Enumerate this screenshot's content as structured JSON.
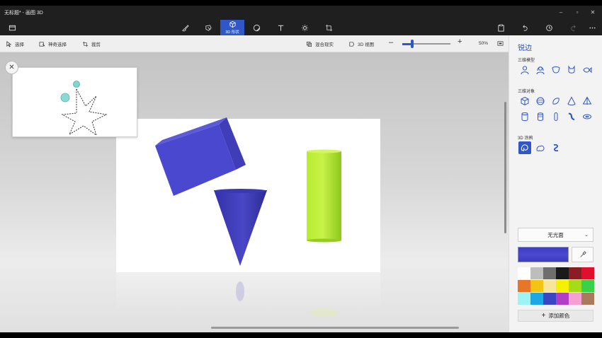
{
  "window": {
    "title": "无标题* - 画图 3D",
    "controls": [
      "minimize",
      "maximize",
      "close"
    ]
  },
  "toolbar": {
    "tools": [
      {
        "name": "menu",
        "icon": "folder-icon"
      },
      {
        "name": "brushes",
        "icon": "brush-icon"
      },
      {
        "name": "2d-shapes",
        "icon": "2d-shape-icon"
      },
      {
        "name": "3d-shapes",
        "icon": "cube-icon",
        "label": "3D 形状",
        "active": true
      },
      {
        "name": "stickers",
        "icon": "sticker-icon"
      },
      {
        "name": "text",
        "icon": "text-icon"
      },
      {
        "name": "effects",
        "icon": "sun-icon"
      },
      {
        "name": "canvas",
        "icon": "crop-icon"
      }
    ],
    "right_tools": [
      "paste-icon",
      "undo-icon",
      "history-icon",
      "redo-icon",
      "more-icon"
    ]
  },
  "subbar": {
    "select": "选择",
    "magic_select": "神奇选择",
    "crop": "裁剪",
    "mixed_reality": "混合现实",
    "view_3d": "3D 视图",
    "zoom": "50%",
    "zoom_fraction": 0.2
  },
  "panel": {
    "title": "锐边",
    "section_models": "三维模型",
    "section_objects": "三维对象",
    "section_doodles": "3D 涂鸦",
    "finish": "无光面",
    "current_color": "#3d3bc0",
    "add_color": "添加颜色",
    "palette": [
      "#ffffff",
      "#bdbdbd",
      "#6e6e6e",
      "#1a1a1a",
      "#8c1c24",
      "#e0102c",
      "#e8762a",
      "#f2c416",
      "#f7e59a",
      "#f5f000",
      "#a4dc18",
      "#38d148",
      "#9ef4f4",
      "#1ea7e6",
      "#3a45c4",
      "#b23ec6",
      "#f4a0d2",
      "#a97a5e"
    ]
  }
}
